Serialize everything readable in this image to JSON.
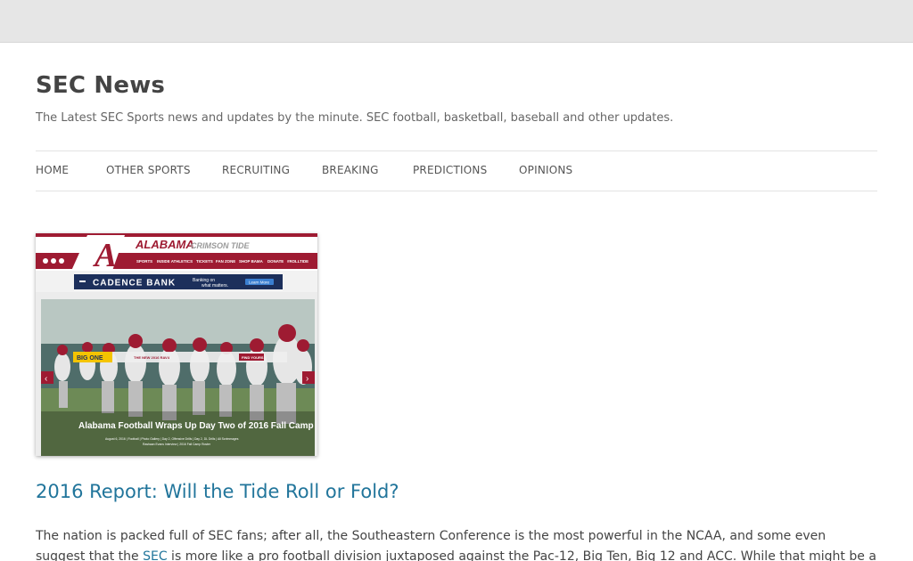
{
  "site": {
    "title": "SEC News",
    "tagline": "The Latest SEC Sports news and updates by the minute. SEC football, basketball, baseball and other updates."
  },
  "nav": {
    "items": [
      {
        "label": "HOME"
      },
      {
        "label": "OTHER SPORTS"
      },
      {
        "label": "RECRUITING"
      },
      {
        "label": "BREAKING"
      },
      {
        "label": "PREDICTIONS"
      },
      {
        "label": "OPINIONS"
      }
    ]
  },
  "post": {
    "title": "2016 Report: Will the Tide Roll or Fold?",
    "excerpt_before": "The nation is packed full of SEC fans; after all, the Southeastern Conference is the most powerful in the NCAA, and some even suggest that the ",
    "excerpt_link": "SEC",
    "excerpt_after": " is more like a pro football division juxtaposed against the Pac-12, Big Ten, Big 12 and ACC. While that might be a touch on the hyperbolic",
    "image": {
      "school_name": "ALABAMA",
      "school_sub": "CRIMSON TIDE",
      "logo_letter": "A",
      "menu_items": [
        "SPORTS",
        "INSIDE ATHLETICS",
        "TICKETS",
        "FAN ZONE",
        "SHOP BAMA",
        "DONATE",
        "#ROLLTIDE"
      ],
      "sponsor": "CADENCE BANK",
      "sponsor_tagline_1": "Banking on",
      "sponsor_tagline_2": "what matters.",
      "sponsor_button": "Learn More",
      "banner_ad": "BIG ONE",
      "banner_text": "THE NEW 2016 RAV4",
      "banner_button": "FIND YOURS",
      "caption": "Alabama Football Wraps Up Day Two of 2016 Fall Camp",
      "meta_line_1": "August 6, 2016  |  Football  |  Photo Gallery  |  Day 2, Offensive Drills  |  Day 2, DL Drills  |  All Scrimmages",
      "meta_line_2": "Rashaan Evans Interview  |  2016 Fall Camp Roster",
      "colors": {
        "crimson": "#9e1b32",
        "navy": "#1c2f5b",
        "field": "#6d8a56"
      }
    }
  }
}
